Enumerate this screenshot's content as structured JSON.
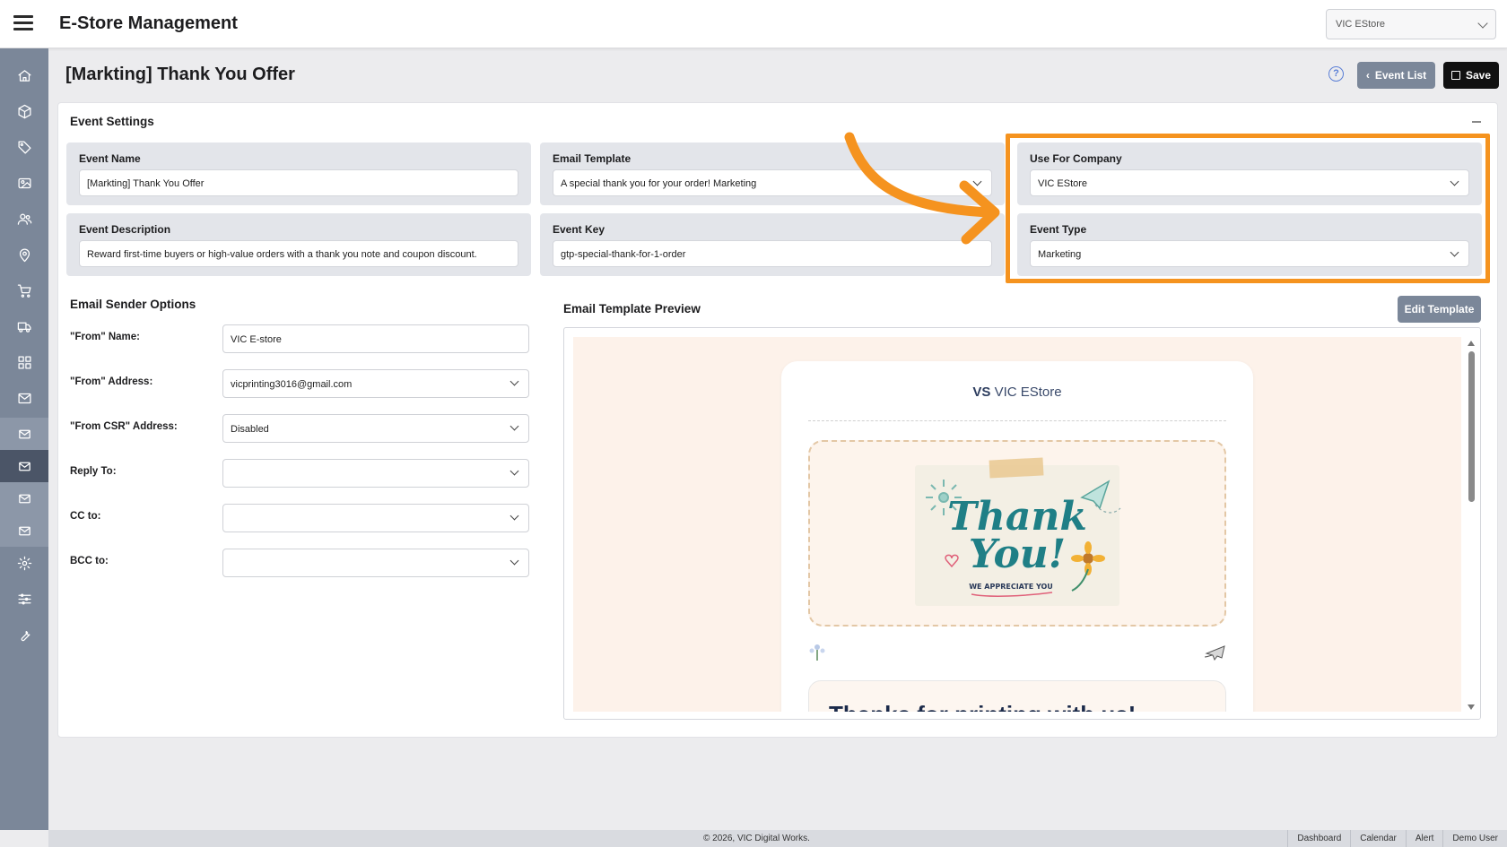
{
  "header": {
    "app_title": "E-Store Management",
    "store_selector": "VIC EStore"
  },
  "sidebar": {
    "items": [
      "home-icon",
      "box-icon",
      "tag-icon",
      "images-icon",
      "users-icon",
      "location-icon",
      "cart-icon",
      "truck-icon",
      "dashboard-icon",
      "mail-icon",
      "mail-sub-icon",
      "mail-active-icon",
      "mail-sub-icon",
      "mail-sub-icon",
      "gear-icon",
      "sliders-icon",
      "wrench-icon"
    ]
  },
  "page": {
    "title": "[Markting] Thank You Offer",
    "help_icon": "?",
    "event_list_label": "Event List",
    "save_label": "Save"
  },
  "event_settings": {
    "title": "Event Settings",
    "event_name": {
      "label": "Event Name",
      "value": "[Markting] Thank You Offer"
    },
    "email_template": {
      "label": "Email Template",
      "value": "A special thank you for your order! Marketing"
    },
    "use_for_company": {
      "label": "Use For Company",
      "value": "VIC EStore"
    },
    "event_description": {
      "label": "Event Description",
      "value": "Reward first-time buyers or high-value orders with a thank you note and coupon discount."
    },
    "event_key": {
      "label": "Event Key",
      "value": "gtp-special-thank-for-1-order"
    },
    "event_type": {
      "label": "Event Type",
      "value": "Marketing"
    }
  },
  "sender_options": {
    "title": "Email Sender Options",
    "from_name": {
      "label": "\"From\" Name:",
      "value": "VIC E-store"
    },
    "from_address": {
      "label": "\"From\" Address:",
      "value": "vicprinting3016@gmail.com"
    },
    "from_csr": {
      "label": "\"From CSR\" Address:",
      "value": "Disabled"
    },
    "reply_to": {
      "label": "Reply To:",
      "value": ""
    },
    "cc_to": {
      "label": "CC to:",
      "value": ""
    },
    "bcc_to": {
      "label": "BCC to:",
      "value": ""
    }
  },
  "preview": {
    "title": "Email Template Preview",
    "edit_label": "Edit Template",
    "logo_mark": "VS",
    "logo_text": "VIC EStore",
    "hero_line1": "Thank",
    "hero_line2": "You!",
    "hero_tagline": "WE APPRECIATE YOU",
    "headline": "Thanks for printing with us!"
  },
  "annotation": {
    "color": "#f5931f"
  },
  "footer": {
    "copyright": "© 2026, VIC Digital Works.",
    "links": [
      "Dashboard",
      "Calendar",
      "Alert",
      "Demo User"
    ]
  }
}
